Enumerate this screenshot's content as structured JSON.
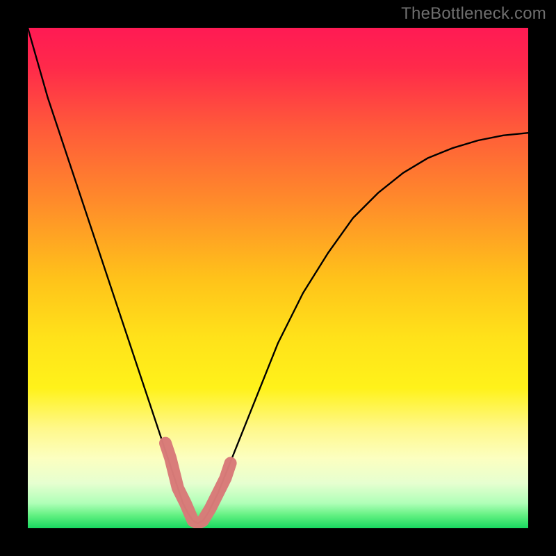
{
  "watermark": "TheBottleneck.com",
  "chart_data": {
    "type": "line",
    "title": "",
    "xlabel": "",
    "ylabel": "",
    "xlim": [
      0,
      100
    ],
    "ylim": [
      0,
      100
    ],
    "series": [
      {
        "name": "curve",
        "x": [
          0,
          2,
          4,
          6,
          8,
          10,
          12,
          14,
          16,
          18,
          20,
          22,
          24,
          26,
          28,
          30,
          31,
          32,
          33,
          34,
          35,
          36,
          38,
          40,
          42,
          44,
          46,
          48,
          50,
          55,
          60,
          65,
          70,
          75,
          80,
          85,
          90,
          95,
          100
        ],
        "y": [
          100,
          93,
          86,
          80,
          74,
          68,
          62,
          56,
          50,
          44,
          38,
          32,
          26,
          20,
          14,
          8,
          5,
          3,
          1.5,
          1,
          1.5,
          3,
          7,
          12,
          17,
          22,
          27,
          32,
          37,
          47,
          55,
          62,
          67,
          71,
          74,
          76,
          77.5,
          78.5,
          79
        ]
      },
      {
        "name": "highlight",
        "x": [
          27.5,
          28.5,
          30,
          31.5,
          33,
          34,
          35,
          36.5,
          38,
          39.5,
          40.5
        ],
        "y": [
          17,
          14,
          8,
          5,
          1.5,
          1,
          1.5,
          4,
          7,
          10,
          13
        ]
      }
    ],
    "gradient_bands": [
      {
        "stop": 0.0,
        "color": "#ff1a54"
      },
      {
        "stop": 0.08,
        "color": "#ff2a4a"
      },
      {
        "stop": 0.2,
        "color": "#ff5a3a"
      },
      {
        "stop": 0.35,
        "color": "#ff8c2a"
      },
      {
        "stop": 0.5,
        "color": "#ffc21a"
      },
      {
        "stop": 0.62,
        "color": "#ffe21a"
      },
      {
        "stop": 0.72,
        "color": "#fff21a"
      },
      {
        "stop": 0.8,
        "color": "#fff88a"
      },
      {
        "stop": 0.86,
        "color": "#fcffc0"
      },
      {
        "stop": 0.91,
        "color": "#e6ffd0"
      },
      {
        "stop": 0.95,
        "color": "#b0ffb8"
      },
      {
        "stop": 0.975,
        "color": "#60f080"
      },
      {
        "stop": 1.0,
        "color": "#18d860"
      }
    ],
    "colors": {
      "curve": "#000000",
      "highlight": "#d87a78"
    }
  }
}
